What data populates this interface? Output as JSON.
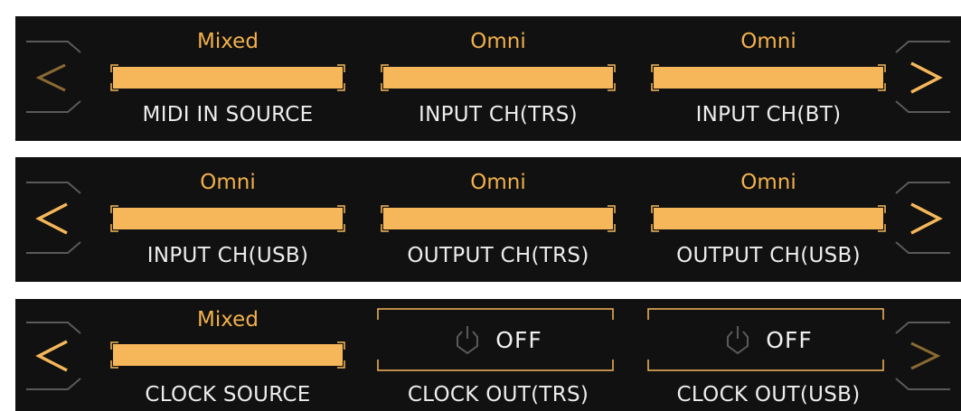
{
  "colors": {
    "accent": "#f5b75a",
    "accent_dim": "#8a6a33",
    "panel_bg": "#111111",
    "frame_gray": "#5a5a5a",
    "label_text": "#ededed"
  },
  "panels": [
    {
      "nav_left": {
        "icon": "chevron-left-icon",
        "active": false
      },
      "nav_right": {
        "icon": "chevron-right-icon",
        "active": true
      },
      "slots": [
        {
          "kind": "bar",
          "value": "Mixed",
          "label": "MIDI IN SOURCE"
        },
        {
          "kind": "bar",
          "value": "Omni",
          "label": "INPUT CH(TRS)"
        },
        {
          "kind": "bar",
          "value": "Omni",
          "label": "INPUT CH(BT)"
        }
      ]
    },
    {
      "nav_left": {
        "icon": "chevron-left-icon",
        "active": true
      },
      "nav_right": {
        "icon": "chevron-right-icon",
        "active": true
      },
      "slots": [
        {
          "kind": "bar",
          "value": "Omni",
          "label": "INPUT CH(USB)"
        },
        {
          "kind": "bar",
          "value": "Omni",
          "label": "OUTPUT CH(TRS)"
        },
        {
          "kind": "bar",
          "value": "Omni",
          "label": "OUTPUT CH(USB)"
        }
      ]
    },
    {
      "nav_left": {
        "icon": "chevron-left-icon",
        "active": true
      },
      "nav_right": {
        "icon": "chevron-right-icon",
        "active": false
      },
      "slots": [
        {
          "kind": "bar",
          "value": "Mixed",
          "label": "CLOCK SOURCE"
        },
        {
          "kind": "toggle",
          "state": "OFF",
          "icon": "power-icon",
          "label": "CLOCK OUT(TRS)"
        },
        {
          "kind": "toggle",
          "state": "OFF",
          "icon": "power-icon",
          "label": "CLOCK OUT(USB)"
        }
      ]
    }
  ]
}
